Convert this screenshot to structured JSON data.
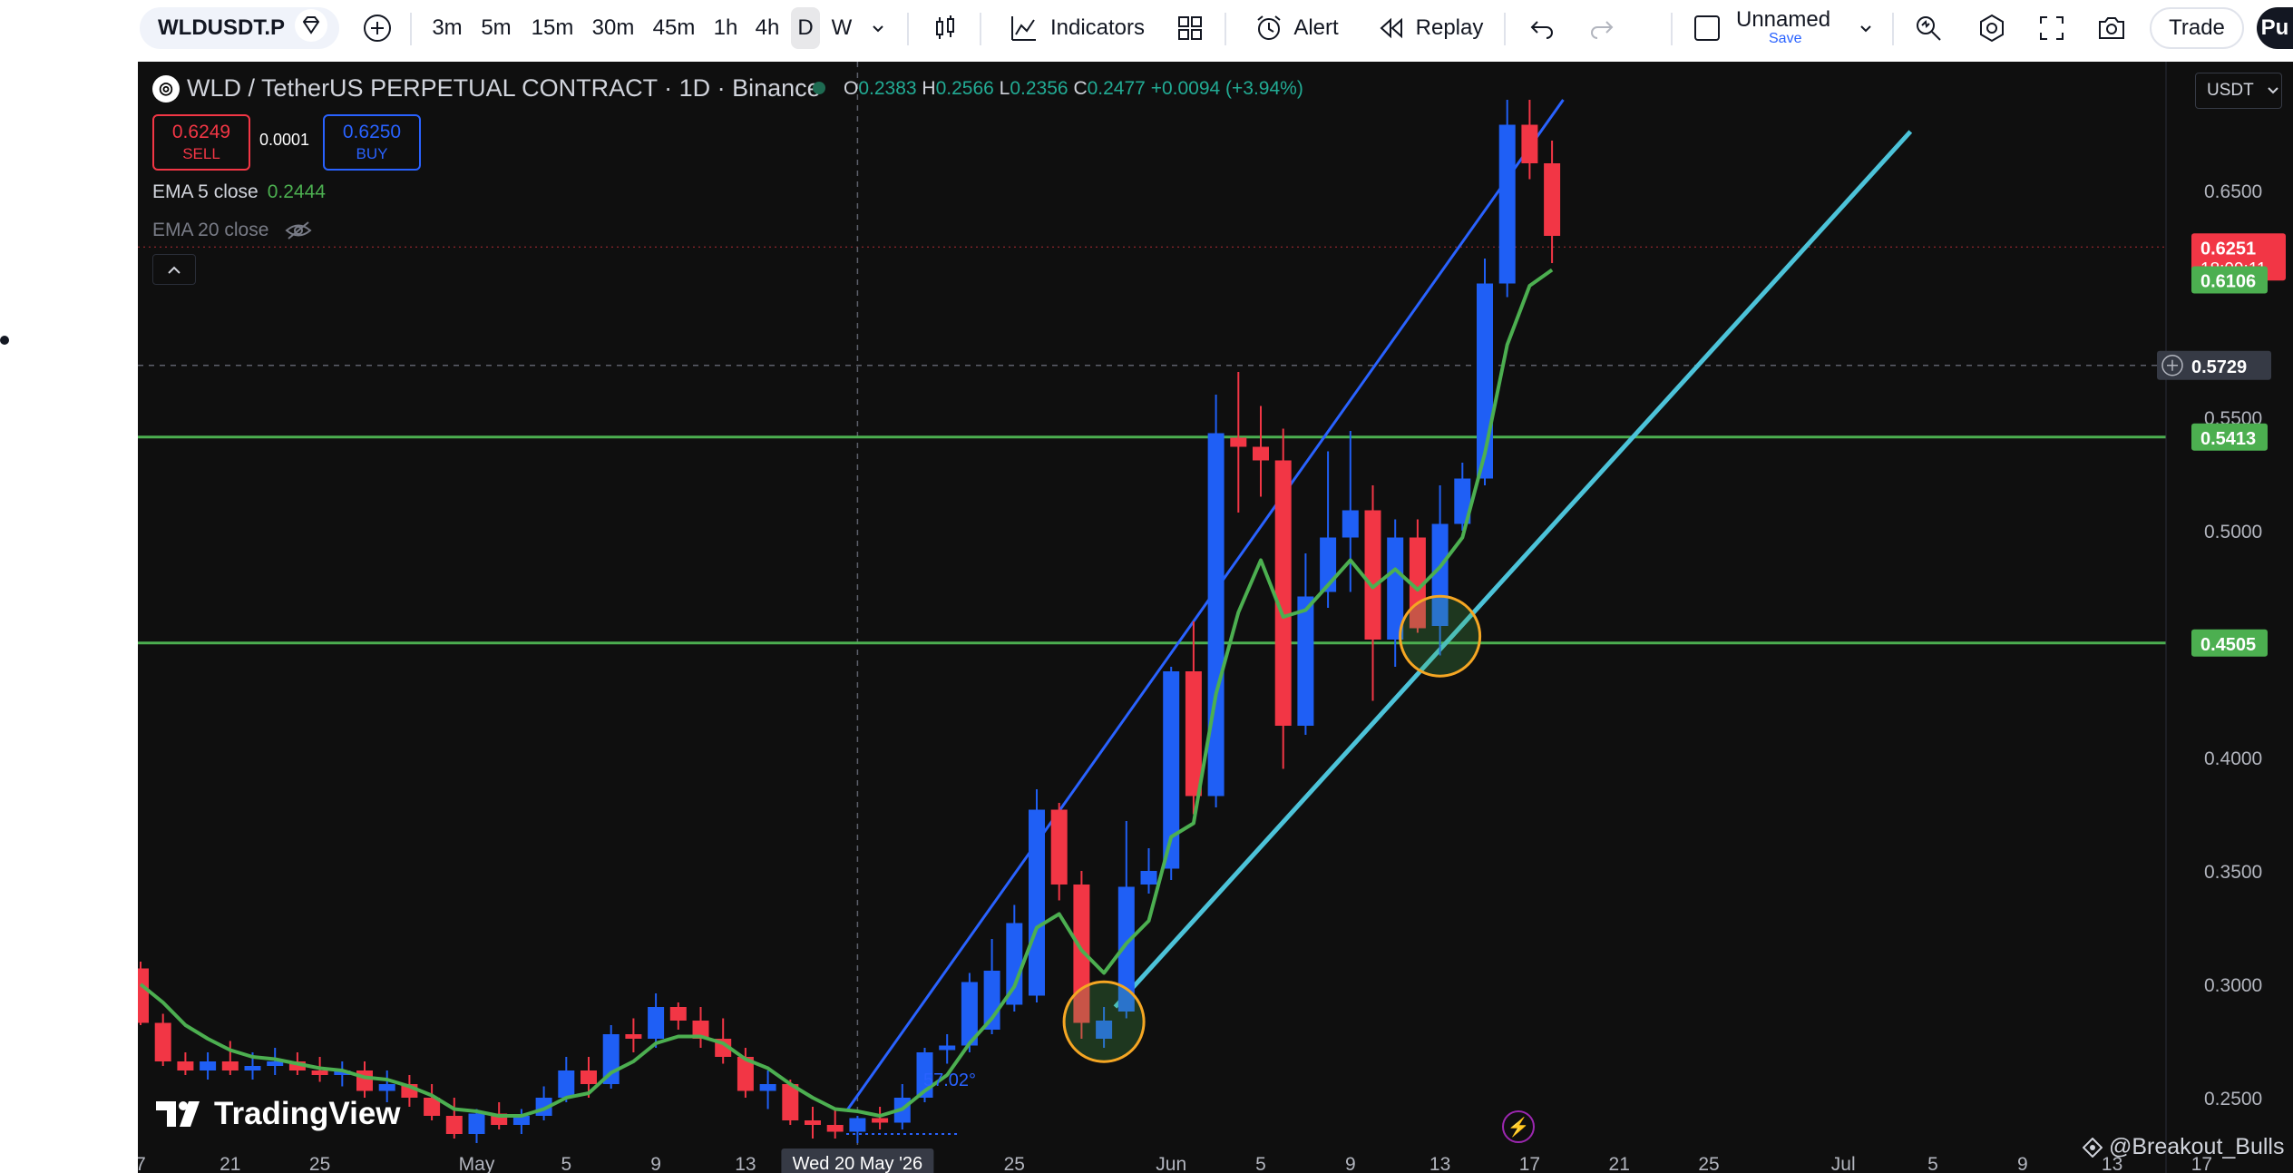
{
  "toolbar": {
    "symbol": "WLDUSDT.P",
    "timeframes": [
      "3m",
      "5m",
      "15m",
      "30m",
      "45m",
      "1h",
      "4h",
      "D",
      "W"
    ],
    "active_timeframe": "D",
    "indicators_label": "Indicators",
    "alert_label": "Alert",
    "replay_label": "Replay",
    "layout_name": "Unnamed",
    "save_label": "Save",
    "trade_label": "Trade",
    "publish_label": "Pu"
  },
  "legend": {
    "title": "WLD / TetherUS PERPETUAL CONTRACT · 1D · Binance",
    "o_key": "O",
    "o": "0.2383",
    "h_key": "H",
    "h": "0.2566",
    "l_key": "L",
    "l": "0.2356",
    "c_key": "C",
    "c": "0.2477",
    "change": "+0.0094 (+3.94%)",
    "sell_price": "0.6249",
    "sell_label": "SELL",
    "spread": "0.0001",
    "buy_price": "0.6250",
    "buy_label": "BUY",
    "ema5_label": "EMA 5 close",
    "ema5_value": "0.2444",
    "ema20_label": "EMA 20 close"
  },
  "currency": "USDT",
  "watermark": "TradingView",
  "credit": "@Breakout_Bulls",
  "angle_label": "57.02°",
  "colors": {
    "up": "#1f5ff5",
    "down": "#f23645",
    "ema": "#4caf50",
    "support_line": "#4cc3d9",
    "channel_line": "#2962ff",
    "level_line": "#4caf50",
    "highlight_circle": "#f5a623",
    "background": "#0f0f0f"
  },
  "chart_data": {
    "type": "candlestick",
    "title": "WLD / TetherUS PERPETUAL CONTRACT · 1D · Binance",
    "ylim": [
      0.22,
      0.69
    ],
    "y_ticks": [
      "0.2500",
      "0.3000",
      "0.3500",
      "0.4000",
      "0.4500",
      "0.5000",
      "0.5500",
      "0.6500"
    ],
    "x_ticks": [
      {
        "label": "7",
        "i": -35
      },
      {
        "label": "21",
        "i": -31
      },
      {
        "label": "25",
        "i": -27
      },
      {
        "label": "May",
        "i": -20
      },
      {
        "label": "5",
        "i": -16
      },
      {
        "label": "9",
        "i": -12
      },
      {
        "label": "13",
        "i": -8
      },
      {
        "label": "25",
        "i": 4
      },
      {
        "label": "Jun",
        "i": 11
      },
      {
        "label": "5",
        "i": 15
      },
      {
        "label": "9",
        "i": 19
      },
      {
        "label": "13",
        "i": 23
      },
      {
        "label": "17",
        "i": 27
      },
      {
        "label": "21",
        "i": 31
      },
      {
        "label": "25",
        "i": 35
      },
      {
        "label": "Jul",
        "i": 41
      },
      {
        "label": "5",
        "i": 45
      },
      {
        "label": "9",
        "i": 49
      },
      {
        "label": "13",
        "i": 53
      },
      {
        "label": "17",
        "i": 57
      }
    ],
    "crosshair_date": "Wed 20 May '26",
    "candles": [
      {
        "o": 0.307,
        "h": 0.31,
        "l": 0.282,
        "c": 0.283
      },
      {
        "o": 0.283,
        "h": 0.287,
        "l": 0.264,
        "c": 0.266
      },
      {
        "o": 0.266,
        "h": 0.27,
        "l": 0.26,
        "c": 0.262
      },
      {
        "o": 0.262,
        "h": 0.27,
        "l": 0.258,
        "c": 0.266
      },
      {
        "o": 0.266,
        "h": 0.275,
        "l": 0.26,
        "c": 0.262
      },
      {
        "o": 0.262,
        "h": 0.27,
        "l": 0.258,
        "c": 0.264
      },
      {
        "o": 0.264,
        "h": 0.272,
        "l": 0.26,
        "c": 0.266
      },
      {
        "o": 0.266,
        "h": 0.27,
        "l": 0.26,
        "c": 0.262
      },
      {
        "o": 0.262,
        "h": 0.268,
        "l": 0.257,
        "c": 0.26
      },
      {
        "o": 0.26,
        "h": 0.266,
        "l": 0.255,
        "c": 0.262
      },
      {
        "o": 0.262,
        "h": 0.266,
        "l": 0.25,
        "c": 0.253
      },
      {
        "o": 0.253,
        "h": 0.262,
        "l": 0.248,
        "c": 0.256
      },
      {
        "o": 0.256,
        "h": 0.26,
        "l": 0.246,
        "c": 0.25
      },
      {
        "o": 0.25,
        "h": 0.256,
        "l": 0.24,
        "c": 0.242
      },
      {
        "o": 0.242,
        "h": 0.25,
        "l": 0.232,
        "c": 0.234
      },
      {
        "o": 0.234,
        "h": 0.245,
        "l": 0.23,
        "c": 0.243
      },
      {
        "o": 0.243,
        "h": 0.248,
        "l": 0.236,
        "c": 0.238
      },
      {
        "o": 0.238,
        "h": 0.245,
        "l": 0.234,
        "c": 0.242
      },
      {
        "o": 0.242,
        "h": 0.255,
        "l": 0.24,
        "c": 0.25
      },
      {
        "o": 0.25,
        "h": 0.268,
        "l": 0.248,
        "c": 0.262
      },
      {
        "o": 0.262,
        "h": 0.268,
        "l": 0.25,
        "c": 0.256
      },
      {
        "o": 0.256,
        "h": 0.282,
        "l": 0.254,
        "c": 0.278
      },
      {
        "o": 0.278,
        "h": 0.285,
        "l": 0.27,
        "c": 0.276
      },
      {
        "o": 0.276,
        "h": 0.296,
        "l": 0.272,
        "c": 0.29
      },
      {
        "o": 0.29,
        "h": 0.292,
        "l": 0.28,
        "c": 0.284
      },
      {
        "o": 0.284,
        "h": 0.29,
        "l": 0.272,
        "c": 0.276
      },
      {
        "o": 0.276,
        "h": 0.285,
        "l": 0.265,
        "c": 0.268
      },
      {
        "o": 0.268,
        "h": 0.272,
        "l": 0.25,
        "c": 0.253
      },
      {
        "o": 0.253,
        "h": 0.262,
        "l": 0.245,
        "c": 0.256
      },
      {
        "o": 0.256,
        "h": 0.258,
        "l": 0.238,
        "c": 0.24
      },
      {
        "o": 0.24,
        "h": 0.246,
        "l": 0.232,
        "c": 0.238
      },
      {
        "o": 0.238,
        "h": 0.245,
        "l": 0.232,
        "c": 0.235
      },
      {
        "o": 0.235,
        "h": 0.242,
        "l": 0.23,
        "c": 0.241
      },
      {
        "o": 0.241,
        "h": 0.246,
        "l": 0.236,
        "c": 0.239
      },
      {
        "o": 0.239,
        "h": 0.256,
        "l": 0.236,
        "c": 0.25
      },
      {
        "o": 0.25,
        "h": 0.272,
        "l": 0.248,
        "c": 0.27
      },
      {
        "o": 0.271,
        "h": 0.278,
        "l": 0.265,
        "c": 0.273
      },
      {
        "o": 0.273,
        "h": 0.305,
        "l": 0.27,
        "c": 0.301
      },
      {
        "o": 0.28,
        "h": 0.32,
        "l": 0.278,
        "c": 0.306
      },
      {
        "o": 0.291,
        "h": 0.335,
        "l": 0.288,
        "c": 0.327
      },
      {
        "o": 0.295,
        "h": 0.386,
        "l": 0.292,
        "c": 0.377
      },
      {
        "o": 0.377,
        "h": 0.38,
        "l": 0.337,
        "c": 0.344
      },
      {
        "o": 0.344,
        "h": 0.35,
        "l": 0.276,
        "c": 0.283
      },
      {
        "o": 0.276,
        "h": 0.29,
        "l": 0.272,
        "c": 0.284
      },
      {
        "o": 0.288,
        "h": 0.372,
        "l": 0.285,
        "c": 0.343
      },
      {
        "o": 0.344,
        "h": 0.36,
        "l": 0.34,
        "c": 0.35
      },
      {
        "o": 0.351,
        "h": 0.44,
        "l": 0.346,
        "c": 0.438
      },
      {
        "o": 0.438,
        "h": 0.46,
        "l": 0.375,
        "c": 0.383
      },
      {
        "o": 0.383,
        "h": 0.56,
        "l": 0.378,
        "c": 0.543
      },
      {
        "o": 0.541,
        "h": 0.57,
        "l": 0.508,
        "c": 0.537
      },
      {
        "o": 0.537,
        "h": 0.555,
        "l": 0.515,
        "c": 0.531
      },
      {
        "o": 0.531,
        "h": 0.545,
        "l": 0.395,
        "c": 0.414
      },
      {
        "o": 0.414,
        "h": 0.49,
        "l": 0.41,
        "c": 0.471
      },
      {
        "o": 0.473,
        "h": 0.535,
        "l": 0.466,
        "c": 0.497
      },
      {
        "o": 0.497,
        "h": 0.544,
        "l": 0.473,
        "c": 0.509
      },
      {
        "o": 0.509,
        "h": 0.52,
        "l": 0.425,
        "c": 0.452
      },
      {
        "o": 0.452,
        "h": 0.505,
        "l": 0.44,
        "c": 0.497
      },
      {
        "o": 0.497,
        "h": 0.505,
        "l": 0.455,
        "c": 0.457
      },
      {
        "o": 0.458,
        "h": 0.52,
        "l": 0.445,
        "c": 0.503
      },
      {
        "o": 0.503,
        "h": 0.53,
        "l": 0.5,
        "c": 0.523
      },
      {
        "o": 0.523,
        "h": 0.62,
        "l": 0.52,
        "c": 0.609
      },
      {
        "o": 0.609,
        "h": 0.69,
        "l": 0.603,
        "c": 0.679
      },
      {
        "o": 0.679,
        "h": 0.69,
        "l": 0.655,
        "c": 0.662
      },
      {
        "o": 0.662,
        "h": 0.672,
        "l": 0.618,
        "c": 0.63
      }
    ],
    "ema5": [
      0.3,
      0.292,
      0.282,
      0.276,
      0.271,
      0.268,
      0.267,
      0.265,
      0.263,
      0.262,
      0.259,
      0.258,
      0.255,
      0.251,
      0.245,
      0.244,
      0.242,
      0.242,
      0.245,
      0.25,
      0.252,
      0.261,
      0.266,
      0.274,
      0.277,
      0.277,
      0.274,
      0.267,
      0.263,
      0.256,
      0.25,
      0.245,
      0.244,
      0.242,
      0.245,
      0.253,
      0.26,
      0.274,
      0.285,
      0.299,
      0.325,
      0.331,
      0.315,
      0.305,
      0.318,
      0.328,
      0.365,
      0.371,
      0.428,
      0.464,
      0.487,
      0.462,
      0.465,
      0.476,
      0.487,
      0.475,
      0.483,
      0.474,
      0.484,
      0.497,
      0.534,
      0.582,
      0.608,
      0.615
    ],
    "levels": [
      0.5413,
      0.4505
    ],
    "current_price": 0.6251,
    "countdown": "18:09:11",
    "price_labels": [
      "0.6251",
      "0.6106",
      "0.5729",
      "0.5413",
      "0.4505"
    ],
    "crosshair_price": "0.5729"
  }
}
